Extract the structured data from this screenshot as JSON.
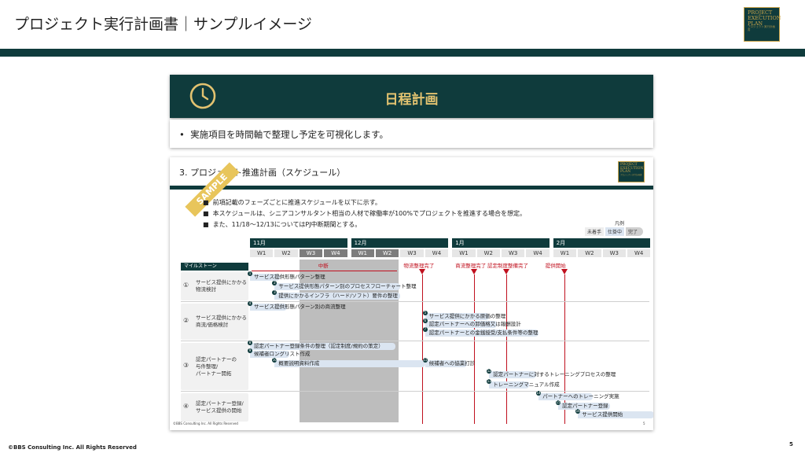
{
  "header": {
    "title": "プロジェクト実行計画書｜サンプルイメージ",
    "logo_lines": [
      "PROJECT",
      "EXECUTION",
      "PLAN"
    ],
    "logo_sub": "プロジェクト実行計画書"
  },
  "section": {
    "title": "日程計画",
    "icon": "clock-icon",
    "intro": "実施項目を時間軸で整理し予定を可視化します。"
  },
  "slide": {
    "title": "3.  プロジェクト推進計画（スケジュール）",
    "ribbon": "SAMPLE",
    "bullets": [
      "前項記載のフェーズごとに推進スケジュールを以下に示す。",
      "本スケジュールは、シニアコンサルタント相当の人材で稼働率が100%でプロジェクトを推進する場合を想定。",
      "また、11/18～12/13についてはPJ中断期間とする。"
    ],
    "legend": {
      "title": "凡例",
      "items": [
        "未着手",
        "仕掛中",
        "完了"
      ]
    },
    "months": [
      "11月",
      "12月",
      "1月",
      "2月"
    ],
    "weeks": [
      "W1",
      "W2",
      "W3",
      "W4",
      "W1",
      "W2",
      "W3",
      "W4",
      "W1",
      "W2",
      "W3",
      "W4",
      "W1",
      "W2",
      "W3",
      "W4"
    ],
    "milestone_label": "マイルストーン",
    "pause_label": "中断",
    "milestones": [
      "物流整理完了",
      "商流整理完了",
      "認定制度整備完了",
      "提供開始"
    ],
    "phases": [
      {
        "num": "①",
        "label": "サービス提供にかかる\n物流検討"
      },
      {
        "num": "②",
        "label": "サービス提供にかかる\n商流/価格検討"
      },
      {
        "num": "③",
        "label": "認定パートナーの\n与件整理/\nパートナー開拓"
      },
      {
        "num": "④",
        "label": "認定パートナー登録/\nサービス提供の開始"
      }
    ],
    "tasks": [
      {
        "no": "1",
        "label": "サービス提供形態パターン整理"
      },
      {
        "no": "2",
        "label": "サービス提供形態パターン別のプロセスフローチャート整理"
      },
      {
        "no": "3",
        "label": "提供にかかるインフラ（ハード/ソフト）要件の整理"
      },
      {
        "no": "4",
        "label": "サービス提供形態パターン別の商流整理"
      },
      {
        "no": "5",
        "label": "サービス提供にかかる原価の整理"
      },
      {
        "no": "6",
        "label": "認定パートナーへの卸価格又は報酬設計"
      },
      {
        "no": "7",
        "label": "認定パートナーとの金銭授受/支払条件等の整理"
      },
      {
        "no": "8",
        "label": "認定パートナー登録条件の整理（認定制度/規約の策定）"
      },
      {
        "no": "9",
        "label": "候補者ロングリスト作成"
      },
      {
        "no": "10",
        "label": "概要説明資料作成"
      },
      {
        "no": "11",
        "label": "候補者への協業打診"
      },
      {
        "no": "12",
        "label": "認定パートナーに対するトレーニングプロセスの整理"
      },
      {
        "no": "13",
        "label": "トレーニングマニュアル作成"
      },
      {
        "no": "14",
        "label": "パートナーへのトレーニング実施"
      },
      {
        "no": "15",
        "label": "認定パートナー登録"
      },
      {
        "no": "16",
        "label": "サービス提供開始"
      }
    ],
    "footer_copyright": "©BBS Consulting Inc. All Rights Reserved",
    "footer_page": "5"
  },
  "footer": {
    "copyright": "©BBS Consulting Inc. All Rights Reserved",
    "page": "5"
  },
  "colors": {
    "brand": "#0f3b3c",
    "gold": "#e2c270",
    "milestone": "#c0101e"
  }
}
